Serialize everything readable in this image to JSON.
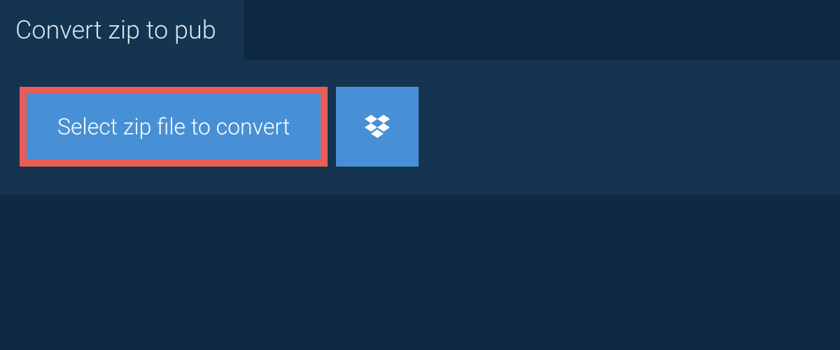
{
  "tab": {
    "title": "Convert zip to pub"
  },
  "buttons": {
    "select_file_label": "Select zip file to convert"
  },
  "icons": {
    "dropbox": "dropbox-icon"
  },
  "colors": {
    "background_dark": "#0f2942",
    "panel": "#143450",
    "button_blue": "#4890d5",
    "highlight_border": "#e85d56",
    "text_light": "#d9e6f2"
  }
}
